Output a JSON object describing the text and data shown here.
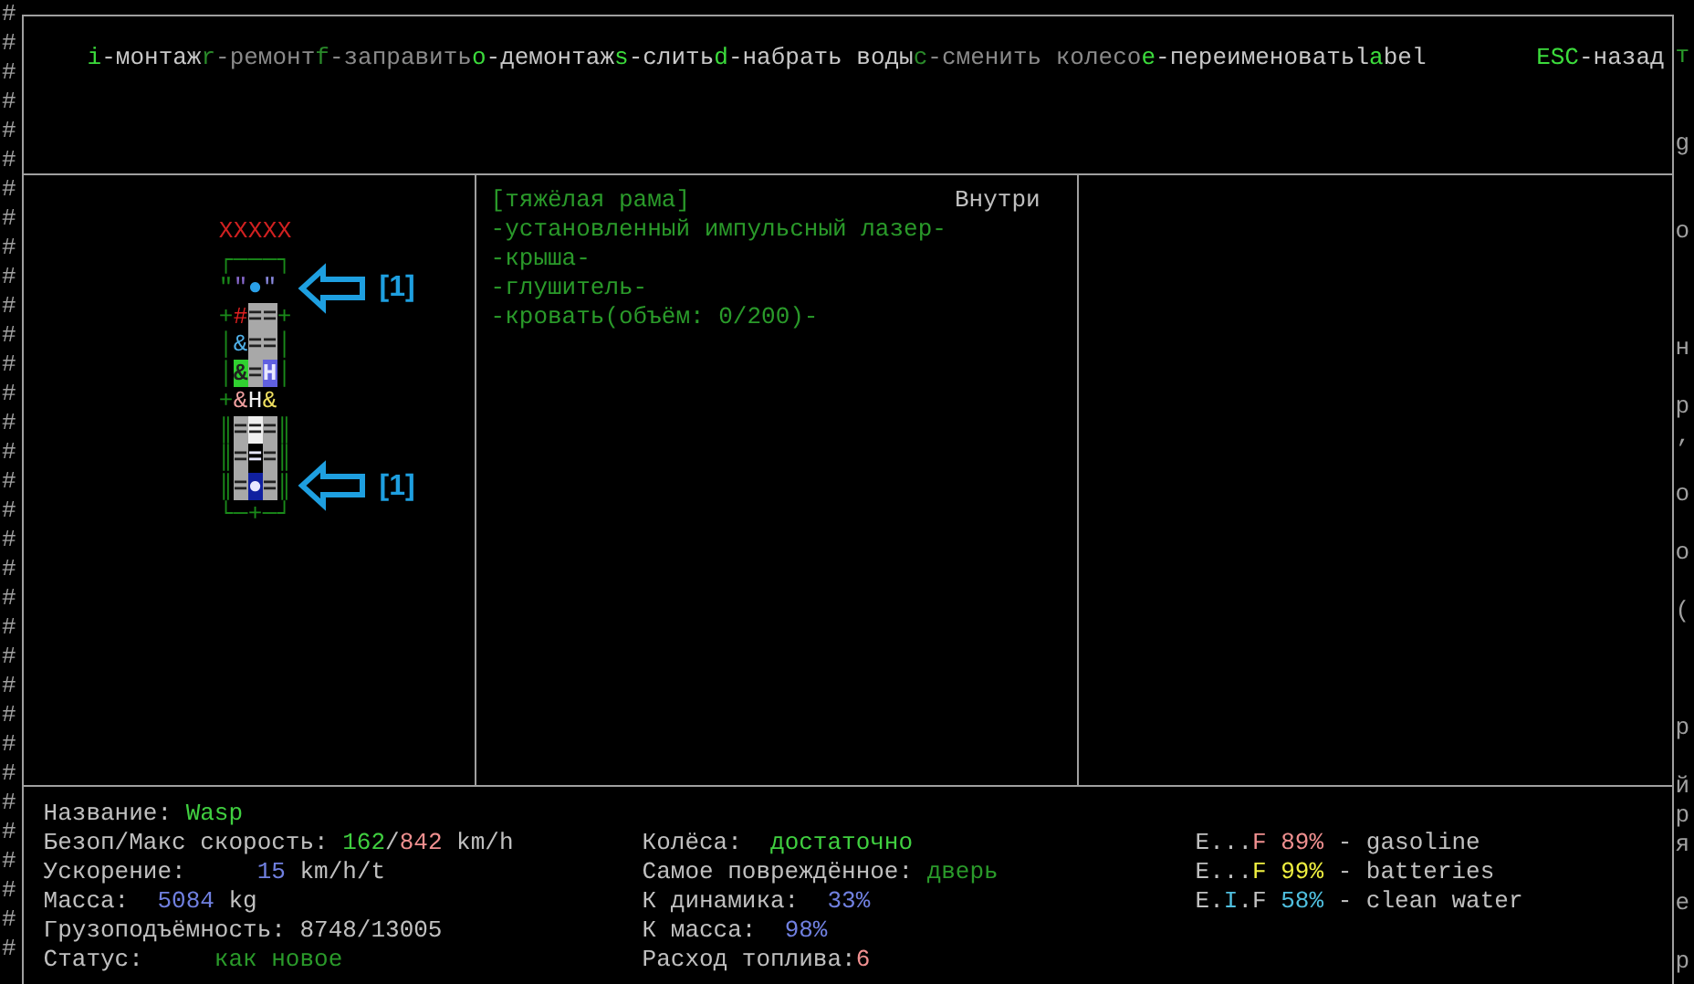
{
  "left_edge": "#################################",
  "keybinds": [
    {
      "key": "i",
      "label": "-монтаж",
      "enabled": true
    },
    {
      "key": "r",
      "label": "-ремонт",
      "enabled": false
    },
    {
      "key": "f",
      "label": "-заправить",
      "enabled": false
    },
    {
      "key": "o",
      "label": "-демонтаж",
      "enabled": true
    },
    {
      "key": "s",
      "label": "-слить",
      "enabled": true
    },
    {
      "key": "d",
      "label": "-набрать воды",
      "enabled": true
    },
    {
      "key": "c",
      "label": "-сменить колесо",
      "enabled": false
    },
    {
      "key": "e",
      "label": "-переименовать",
      "enabled": true
    },
    {
      "prefix": "l",
      "key": "a",
      "label": "bel",
      "enabled": true
    }
  ],
  "back": {
    "key": "ESC",
    "label": "-назад",
    "enabled": true
  },
  "vehicle": {
    "rows": [
      {
        "cells": [
          {
            "ch": "X",
            "color": "#d02020"
          },
          {
            "ch": "X",
            "color": "#d02020"
          },
          {
            "ch": "X",
            "color": "#d02020"
          },
          {
            "ch": "X",
            "color": "#d02020"
          },
          {
            "ch": "X",
            "color": "#d02020"
          }
        ]
      },
      {
        "cells": [
          {
            "ch": "┌",
            "color": "#1a8a1a"
          },
          {
            "ch": "─",
            "color": "#1a8a1a"
          },
          {
            "ch": "─",
            "color": "#1a8a1a"
          },
          {
            "ch": "─",
            "color": "#1a8a1a"
          },
          {
            "ch": "┐",
            "color": "#1a8a1a"
          }
        ]
      },
      {
        "cells": [
          {
            "ch": "\"",
            "color": "#1a8a1a"
          },
          {
            "ch": "\"",
            "color": "#8a6ad0"
          },
          {
            "ch": "●",
            "color": "#2aa0e8"
          },
          {
            "ch": "\"",
            "color": "#8a8ae0"
          },
          null
        ],
        "callout": "[1]"
      },
      {
        "cells": [
          {
            "ch": "+",
            "color": "#1a8a1a"
          },
          {
            "ch": "#",
            "color": "#e02020"
          },
          {
            "ch": "=",
            "kind": "block",
            "color": "#a8a8a8"
          },
          {
            "ch": "=",
            "kind": "block",
            "color": "#a8a8a8"
          },
          {
            "ch": "+",
            "color": "#1a8a1a"
          }
        ]
      },
      {
        "cells": [
          {
            "ch": "│",
            "color": "#1a8a1a"
          },
          {
            "ch": "&",
            "color": "#50b0e8"
          },
          {
            "ch": "=",
            "kind": "block",
            "color": "#a8a8a8"
          },
          {
            "ch": "=",
            "kind": "block",
            "color": "#a8a8a8"
          },
          {
            "ch": "│",
            "color": "#1a8a1a"
          }
        ]
      },
      {
        "cells": [
          {
            "ch": "│",
            "color": "#1a8a1a"
          },
          {
            "ch": "&",
            "kind": "block",
            "color": "#30d030"
          },
          {
            "ch": "=",
            "kind": "block",
            "color": "#a8a8a8"
          },
          {
            "ch": "H",
            "kind": "block",
            "color": "#6060e0"
          },
          {
            "ch": "│",
            "color": "#1a8a1a"
          }
        ]
      },
      {
        "cells": [
          {
            "ch": "+",
            "color": "#1a8a1a"
          },
          {
            "ch": "&",
            "color": "#f0a0a0"
          },
          {
            "ch": "H",
            "color": "#f0f0f0"
          },
          {
            "ch": "&",
            "color": "#f0e060"
          },
          null
        ]
      },
      {
        "cells": [
          {
            "ch": "║",
            "color": "#1a8a1a"
          },
          {
            "ch": "=",
            "kind": "block",
            "color": "#a8a8a8"
          },
          {
            "ch": "=",
            "kind": "block",
            "color": "#f0f0f0"
          },
          {
            "ch": "=",
            "kind": "block",
            "color": "#a8a8a8"
          },
          {
            "ch": "║",
            "color": "#1a8a1a"
          }
        ]
      },
      {
        "cells": [
          {
            "ch": "║",
            "color": "#1a8a1a"
          },
          {
            "ch": "=",
            "kind": "block",
            "color": "#a8a8a8"
          },
          {
            "ch": "=",
            "kind": "block",
            "color": "#000000"
          },
          {
            "ch": "=",
            "kind": "block",
            "color": "#a8a8a8"
          },
          {
            "ch": "║",
            "color": "#1a8a1a"
          }
        ]
      },
      {
        "cells": [
          {
            "ch": "║",
            "color": "#1a8a1a"
          },
          {
            "ch": "=",
            "kind": "block",
            "color": "#a8a8a8"
          },
          {
            "ch": "●",
            "kind": "block",
            "color": "#1020a0"
          },
          {
            "ch": "=",
            "kind": "block",
            "color": "#a8a8a8"
          },
          {
            "ch": "║",
            "color": "#1a8a1a"
          }
        ],
        "callout": "[1]"
      },
      {
        "cells": [
          {
            "ch": "└",
            "color": "#1a8a1a"
          },
          {
            "ch": "─",
            "color": "#1a8a1a"
          },
          {
            "ch": "+",
            "color": "#1a8a1a"
          },
          {
            "ch": "─",
            "color": "#1a8a1a"
          },
          {
            "ch": "┘",
            "color": "#1a8a1a"
          }
        ]
      }
    ]
  },
  "parts": {
    "title": "[тяжёлая рама]",
    "location": "Внутри",
    "items": [
      "-установленный импульсный лазер-",
      "-крыша-",
      "-глушитель-",
      "-кровать(объём: 0/200)-"
    ]
  },
  "stats": [
    [
      [
        {
          "text": "Название: ",
          "color": "#c0c0c0"
        },
        {
          "text": "Wasp",
          "color": "#40d040"
        }
      ],
      [
        {
          "text": "Безоп/Макс скорость: ",
          "color": "#c0c0c0"
        },
        {
          "text": "162",
          "color": "#40d040"
        },
        {
          "text": "/",
          "color": "#c0c0c0"
        },
        {
          "text": "842",
          "color": "#f09090"
        },
        {
          "text": " km/h",
          "color": "#c0c0c0"
        }
      ],
      [
        {
          "text": "Ускорение:     ",
          "color": "#c0c0c0"
        },
        {
          "text": "15",
          "color": "#7080e0"
        },
        {
          "text": " km/h/t",
          "color": "#c0c0c0"
        }
      ],
      [
        {
          "text": "Масса:  ",
          "color": "#c0c0c0"
        },
        {
          "text": "5084",
          "color": "#7080e0"
        },
        {
          "text": " kg",
          "color": "#c0c0c0"
        }
      ],
      [
        {
          "text": "Грузоподъёмность: 8748/13005",
          "color": "#c0c0c0"
        }
      ],
      [
        {
          "text": "Статус:     ",
          "color": "#c0c0c0"
        },
        {
          "text": "как новое",
          "color": "#2a9a2a"
        }
      ]
    ],
    [
      [
        {
          "text": "Колёса:  ",
          "color": "#c0c0c0"
        },
        {
          "text": "достаточно",
          "color": "#40d040"
        }
      ],
      [
        {
          "text": "Самое повреждённое: ",
          "color": "#c0c0c0"
        },
        {
          "text": "дверь",
          "color": "#2a9a2a"
        }
      ],
      [
        {
          "text": "К динамика:  ",
          "color": "#c0c0c0"
        },
        {
          "text": "33%",
          "color": "#7080e0"
        }
      ],
      [
        {
          "text": "К масса:  ",
          "color": "#c0c0c0"
        },
        {
          "text": "98%",
          "color": "#7080e0"
        }
      ],
      [
        {
          "text": "Расход топлива:",
          "color": "#c0c0c0"
        },
        {
          "text": "6",
          "color": "#f09090"
        }
      ]
    ],
    [
      [
        {
          "text": "E...",
          "color": "#c0c0c0"
        },
        {
          "text": "F 89%",
          "color": "#f09090"
        },
        {
          "text": " - gasoline",
          "color": "#c0c0c0"
        }
      ],
      [
        {
          "text": "E...",
          "color": "#c0c0c0"
        },
        {
          "text": "F 99%",
          "color": "#f0f040"
        },
        {
          "text": " - batteries",
          "color": "#c0c0c0"
        }
      ],
      [
        {
          "text": "E.",
          "color": "#c0c0c0"
        },
        {
          "text": "I",
          "color": "#50c0e0"
        },
        {
          "text": ".F ",
          "color": "#c0c0c0"
        },
        {
          "text": "58%",
          "color": "#50c0e0"
        },
        {
          "text": " - clean water",
          "color": "#c0c0c0"
        }
      ]
    ]
  ],
  "right_edge": {
    "top": {
      "text": "т",
      "color": "#2a9a2a"
    },
    "text": "g\n\n\nо\n\n\n\nн\n\nр\n‚\n\nо\n\nо\n\n(\n\n\n\nр\n\nй\nр\nя\n\nе\n\nр",
    "color": "#a0a0a0"
  }
}
